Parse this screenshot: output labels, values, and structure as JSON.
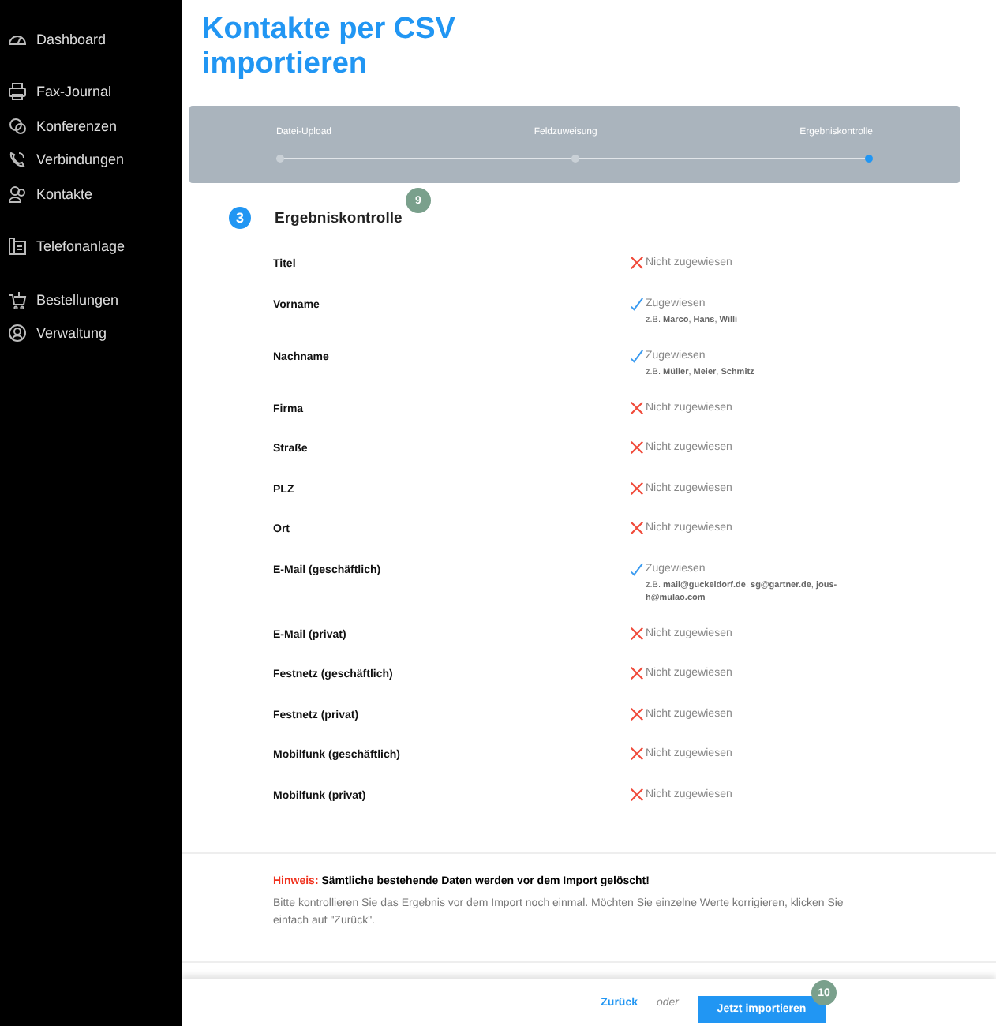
{
  "sidebar": {
    "groups": [
      {
        "items": [
          {
            "label": "Dashboard"
          }
        ]
      },
      {
        "items": [
          {
            "label": "Fax-Journal"
          },
          {
            "label": "Konferenzen"
          },
          {
            "label": "Verbindungen"
          },
          {
            "label": "Kontakte"
          }
        ]
      },
      {
        "items": [
          {
            "label": "Telefonanlage"
          }
        ]
      },
      {
        "items": [
          {
            "label": "Bestellungen"
          },
          {
            "label": "Verwaltung"
          }
        ]
      }
    ]
  },
  "title": "Kontakte per CSV importieren",
  "stepper": {
    "steps": [
      {
        "label": "Datei-Upload",
        "selected": false
      },
      {
        "label": "Feldzuweisung",
        "selected": false
      },
      {
        "label": "Ergebniskontrolle",
        "selected": true
      }
    ]
  },
  "section": {
    "number": "3",
    "title": "Ergebniskontrolle",
    "badge": "9"
  },
  "fields": [
    {
      "label": "Titel",
      "assigned": false,
      "status": "Nicht zugewiesen"
    },
    {
      "label": "Vorname",
      "assigned": true,
      "status": "Zugewiesen",
      "example": "z.B. **Marco**, **Hans**, **Willi**"
    },
    {
      "label": "Nachname",
      "assigned": true,
      "status": "Zugewiesen",
      "example": "z.B. **Müller**, **Meier**, **Schmitz**"
    },
    {
      "label": "Firma",
      "assigned": false,
      "status": "Nicht zugewiesen"
    },
    {
      "label": "Straße",
      "assigned": false,
      "status": "Nicht zugewiesen"
    },
    {
      "label": "PLZ",
      "assigned": false,
      "status": "Nicht zugewiesen"
    },
    {
      "label": "Ort",
      "assigned": false,
      "status": "Nicht zugewiesen"
    },
    {
      "label": "E-Mail (geschäftlich)",
      "assigned": true,
      "status": "Zugewiesen",
      "example": "z.B. **mail@guckeldorf.de**, **sg@gartner.de**, **jous-h@mulao.com**"
    },
    {
      "label": "E-Mail (privat)",
      "assigned": false,
      "status": "Nicht zugewiesen"
    },
    {
      "label": "Festnetz (geschäftlich)",
      "assigned": false,
      "status": "Nicht zugewiesen"
    },
    {
      "label": "Festnetz (privat)",
      "assigned": false,
      "status": "Nicht zugewiesen"
    },
    {
      "label": "Mobilfunk (geschäftlich)",
      "assigned": false,
      "status": "Nicht zugewiesen"
    },
    {
      "label": "Mobilfunk (privat)",
      "assigned": false,
      "status": "Nicht zugewiesen"
    }
  ],
  "hint": {
    "label": "Hinweis:",
    "warning": "Sämtliche bestehende Daten werden vor dem Import gelöscht!",
    "text": "Bitte kontrollieren Sie das Ergebnis vor dem Import noch einmal. Möchten Sie einzelne Werte korrigieren, klicken Sie einfach auf \"Zurück\"."
  },
  "footer": {
    "back": "Zurück",
    "or": "oder",
    "import": "Jetzt importieren",
    "badge": "10"
  }
}
